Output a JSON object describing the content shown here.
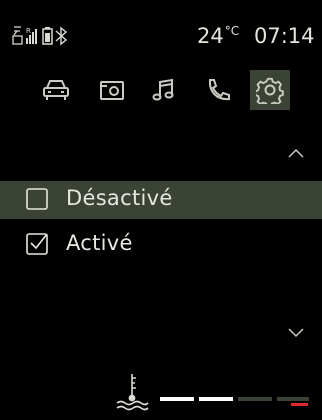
{
  "status": {
    "temperature": "24",
    "temperature_unit": "°C",
    "time": "07:14",
    "icons": [
      "sim-card-icon",
      "signal-icon",
      "battery-icon",
      "bluetooth-icon"
    ]
  },
  "tabs": [
    {
      "name": "vehicle",
      "icon": "car-icon",
      "active": false
    },
    {
      "name": "media",
      "icon": "radio-icon",
      "active": false
    },
    {
      "name": "music",
      "icon": "music-note-icon",
      "active": false
    },
    {
      "name": "phone",
      "icon": "phone-icon",
      "active": false
    },
    {
      "name": "settings",
      "icon": "gear-icon",
      "active": true
    }
  ],
  "options": [
    {
      "label": "Désactivé",
      "checked": false,
      "highlighted": true
    },
    {
      "label": "Activé",
      "checked": true,
      "highlighted": false
    }
  ],
  "footer": {
    "coolant_icon": "coolant-temperature-icon",
    "gauge_segments": 5,
    "gauge_lit": 2,
    "colors": {
      "lit": "#ffffff",
      "unlit": "#3c4436",
      "warning": "#e02a2a"
    }
  },
  "colors": {
    "highlight": "#3b4236",
    "text": "#e6e8df",
    "icon": "#c9ccc2"
  }
}
